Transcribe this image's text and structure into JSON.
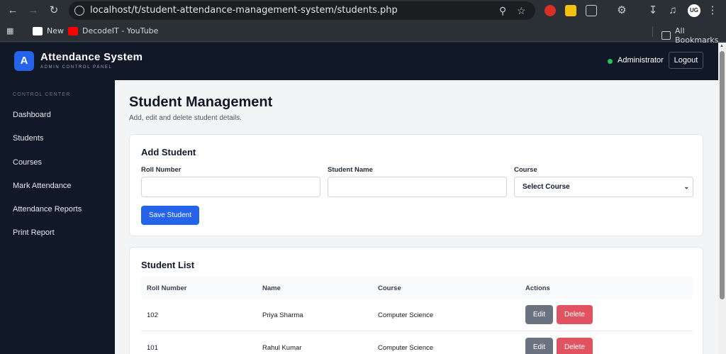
{
  "browser": {
    "url": "localhost/t/student-attendance-management-system/students.php",
    "bookmarks": [
      {
        "label": "New"
      },
      {
        "label": "DecodeIT - YouTube"
      }
    ],
    "all_bookmarks": "All Bookmarks",
    "profile_initials": "UG"
  },
  "header": {
    "logo_letter": "A",
    "title": "Attendance System",
    "subtitle": "ADMIN CONTROL PANEL",
    "user": "Administrator",
    "logout": "Logout"
  },
  "sidebar": {
    "heading": "CONTROL CENTER",
    "items": [
      {
        "label": "Dashboard"
      },
      {
        "label": "Students"
      },
      {
        "label": "Courses"
      },
      {
        "label": "Mark Attendance"
      },
      {
        "label": "Attendance Reports"
      },
      {
        "label": "Print Report"
      }
    ]
  },
  "main": {
    "title": "Student Management",
    "description": "Add, edit and delete student details.",
    "add_form": {
      "title": "Add Student",
      "roll_label": "Roll Number",
      "name_label": "Student Name",
      "course_label": "Course",
      "roll_value": "",
      "name_value": "",
      "course_selected": "Select Course",
      "save_label": "Save Student"
    },
    "list": {
      "title": "Student List",
      "columns": [
        "Roll Number",
        "Name",
        "Course",
        "Actions"
      ],
      "rows": [
        {
          "roll": "102",
          "name": "Priya Sharma",
          "course": "Computer Science",
          "edit": "Edit",
          "delete": "Delete"
        },
        {
          "roll": "101",
          "name": "Rahul Kumar",
          "course": "Computer Science",
          "edit": "Edit",
          "delete": "Delete"
        }
      ]
    }
  },
  "colors": {
    "accent": "#2563eb",
    "header_bg": "#111827",
    "danger": "#e15361",
    "secondary": "#6b7280",
    "online": "#22c55e"
  }
}
